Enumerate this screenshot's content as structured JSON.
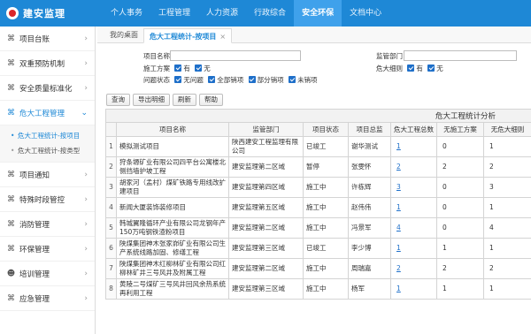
{
  "app": {
    "title": "建安监理"
  },
  "nav": [
    {
      "label": "个人事务",
      "active": false
    },
    {
      "label": "工程管理",
      "active": false
    },
    {
      "label": "人力资源",
      "active": false
    },
    {
      "label": "行政综合",
      "active": false
    },
    {
      "label": "安全环保",
      "active": true
    },
    {
      "label": "文档中心",
      "active": false
    }
  ],
  "sidebar": {
    "items": [
      {
        "label": "项目台账",
        "icon": "gear-icon"
      },
      {
        "label": "双重预防机制",
        "icon": "gear-icon"
      },
      {
        "label": "安全质量标准化",
        "icon": "gear-icon"
      },
      {
        "label": "危大工程管理",
        "icon": "gear-icon",
        "expanded": true
      },
      {
        "label": "项目通知",
        "icon": "gear-icon"
      },
      {
        "label": "特殊时段管控",
        "icon": "gear-icon"
      },
      {
        "label": "消防管理",
        "icon": "gear-icon"
      },
      {
        "label": "环保管理",
        "icon": "gear-icon"
      },
      {
        "label": "培训管理",
        "icon": "person-icon"
      },
      {
        "label": "应急管理",
        "icon": "gear-icon"
      }
    ],
    "subitems": [
      {
        "label": "危大工程统计-按项目",
        "active": true
      },
      {
        "label": "危大工程统计-按类型",
        "active": false
      }
    ]
  },
  "tabs": [
    {
      "label": "我的桌面"
    },
    {
      "label": "危大工程统计-按项目",
      "close": "×"
    }
  ],
  "filter": {
    "project_name_label": "项目名称",
    "dept_label": "监管部门",
    "construction_plan_label": "施工方案",
    "has_label": "有",
    "none_label": "无",
    "large_danger_label": "危大细则",
    "problem_status_label": "问题状态",
    "status_options": [
      "无问题",
      "全部销项",
      "部分销项",
      "未销项"
    ]
  },
  "toolbar": {
    "query": "查询",
    "export": "导出明细",
    "refresh": "刷新",
    "help": "帮助"
  },
  "table": {
    "caption": "危大工程统计分析",
    "headers": [
      "",
      "项目名称",
      "监管部门",
      "项目状态",
      "项目总监",
      "危大工程总数",
      "无施工方案",
      "无危大细则"
    ],
    "rows": [
      {
        "idx": "1",
        "name": "模拟测试项目",
        "dept": "陕西建安工程监理有限公司",
        "status": "已竣工",
        "director": "谢华测试",
        "total": "1",
        "no_plan": "0",
        "no_rule": "1"
      },
      {
        "idx": "2",
        "name": "狩条塬矿业有限公司四平台公寓楼北侧挡墙护坡工程",
        "dept": "建安监理第二区域",
        "status": "暂停",
        "director": "张雯怀",
        "total": "2",
        "no_plan": "2",
        "no_rule": "2"
      },
      {
        "idx": "3",
        "name": "胡家河（孟村）煤矿铁路专用线改扩建项目",
        "dept": "建安监理第四区域",
        "status": "施工中",
        "director": "许栋辉",
        "total": "3",
        "no_plan": "0",
        "no_rule": "3"
      },
      {
        "idx": "4",
        "name": "新闻大厦装饰装修项目",
        "dept": "建安监理第五区域",
        "status": "施工中",
        "director": "赵伟伟",
        "total": "1",
        "no_plan": "0",
        "no_rule": "1"
      },
      {
        "idx": "5",
        "name": "韩城翼隆循环产业有限公司龙钢年产150万吨钢铁渣粉项目",
        "dept": "建安监理第二区域",
        "status": "施工中",
        "director": "冯景军",
        "total": "4",
        "no_plan": "0",
        "no_rule": "4"
      },
      {
        "idx": "6",
        "name": "陕煤集团神木张家峁矿业有限公司生产系统线路加固、修缮工程",
        "dept": "建安监理第三区域",
        "status": "已竣工",
        "director": "李少博",
        "total": "1",
        "no_plan": "1",
        "no_rule": "1"
      },
      {
        "idx": "7",
        "name": "陕煤集团神木红柳林矿业有限公司红柳林矿井三号风井及附属工程",
        "dept": "建安监理第二区域",
        "status": "施工中",
        "director": "周瑞嘉",
        "total": "2",
        "no_plan": "2",
        "no_rule": "2"
      },
      {
        "idx": "8",
        "name": "黄陵二号煤矿三号风井回风余热系统再利用工程",
        "dept": "建安监理第三区域",
        "status": "施工中",
        "director": "杨军",
        "total": "1",
        "no_plan": "1",
        "no_rule": "1"
      }
    ]
  },
  "colors": {
    "topbar": "#1e88d6",
    "accent": "#1e6fc9"
  }
}
